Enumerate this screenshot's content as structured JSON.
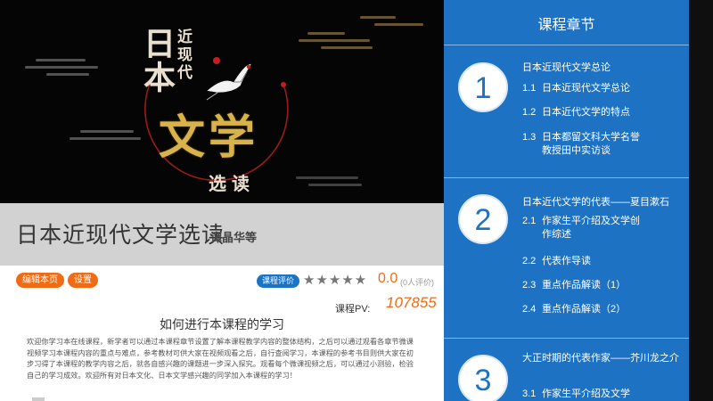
{
  "banner": {
    "title_part1": "日本",
    "title_part2": "近现代",
    "title_part3": "文学",
    "title_part4": "选读"
  },
  "course": {
    "title": "日本近现代文学选读",
    "teacher": "谭晶华等"
  },
  "actions": {
    "edit_label": "编辑本页",
    "settings_label": "设置",
    "evaluation_label": "课程评价",
    "stars": "★★★★★",
    "rating": "0.0",
    "rating_count": "(0人评价)",
    "pv_label": "课程PV:",
    "pv_value": "107855"
  },
  "howto": {
    "title": "如何进行本课程的学习",
    "body": "欢迎你学习本在线课程，新学者可以通过本课程章节设置了解本课程教学内容的整体结构，之后可以通过观看各章节微课视频学习本课程内容的重点与难点，参考教材可供大家在视频观看之后，自行查阅学习，本课程的参考书目则供大家在初步习得了本课程的教学内容之后，就各自感兴趣的课题进一步深入探究。观看每个微课视频之后，可以通过小测验，检验自己的学习成效。欢迎所有对日本文化、日本文学感兴趣的同学加入本课程的学习！"
  },
  "chapters_panel": {
    "title": "课程章节",
    "chapters": [
      {
        "number": "1",
        "title": "日本近现代文学总论",
        "sections": [
          {
            "num": "1.1",
            "label": "日本近现代文学总论"
          },
          {
            "num": "1.2",
            "label": "日本近代文学的特点"
          },
          {
            "num": "1.3",
            "label": "日本都留文科大学名誉教授田中实访谈"
          }
        ]
      },
      {
        "number": "2",
        "title": "日本近代文学的代表——夏目漱石",
        "sections": [
          {
            "num": "2.1",
            "label": "作家生平介绍及文学创作综述"
          },
          {
            "num": "2.2",
            "label": "代表作导读"
          },
          {
            "num": "2.3",
            "label": "重点作品解读（1）"
          },
          {
            "num": "2.4",
            "label": "重点作品解读（2）"
          }
        ]
      },
      {
        "number": "3",
        "title": "大正时期的代表作家——芥川龙之介",
        "sections": [
          {
            "num": "3.1",
            "label": "作家生平介绍及文学"
          }
        ]
      }
    ]
  },
  "colors": {
    "accent_blue": "#1e72c4",
    "accent_orange": "#f06c14"
  }
}
